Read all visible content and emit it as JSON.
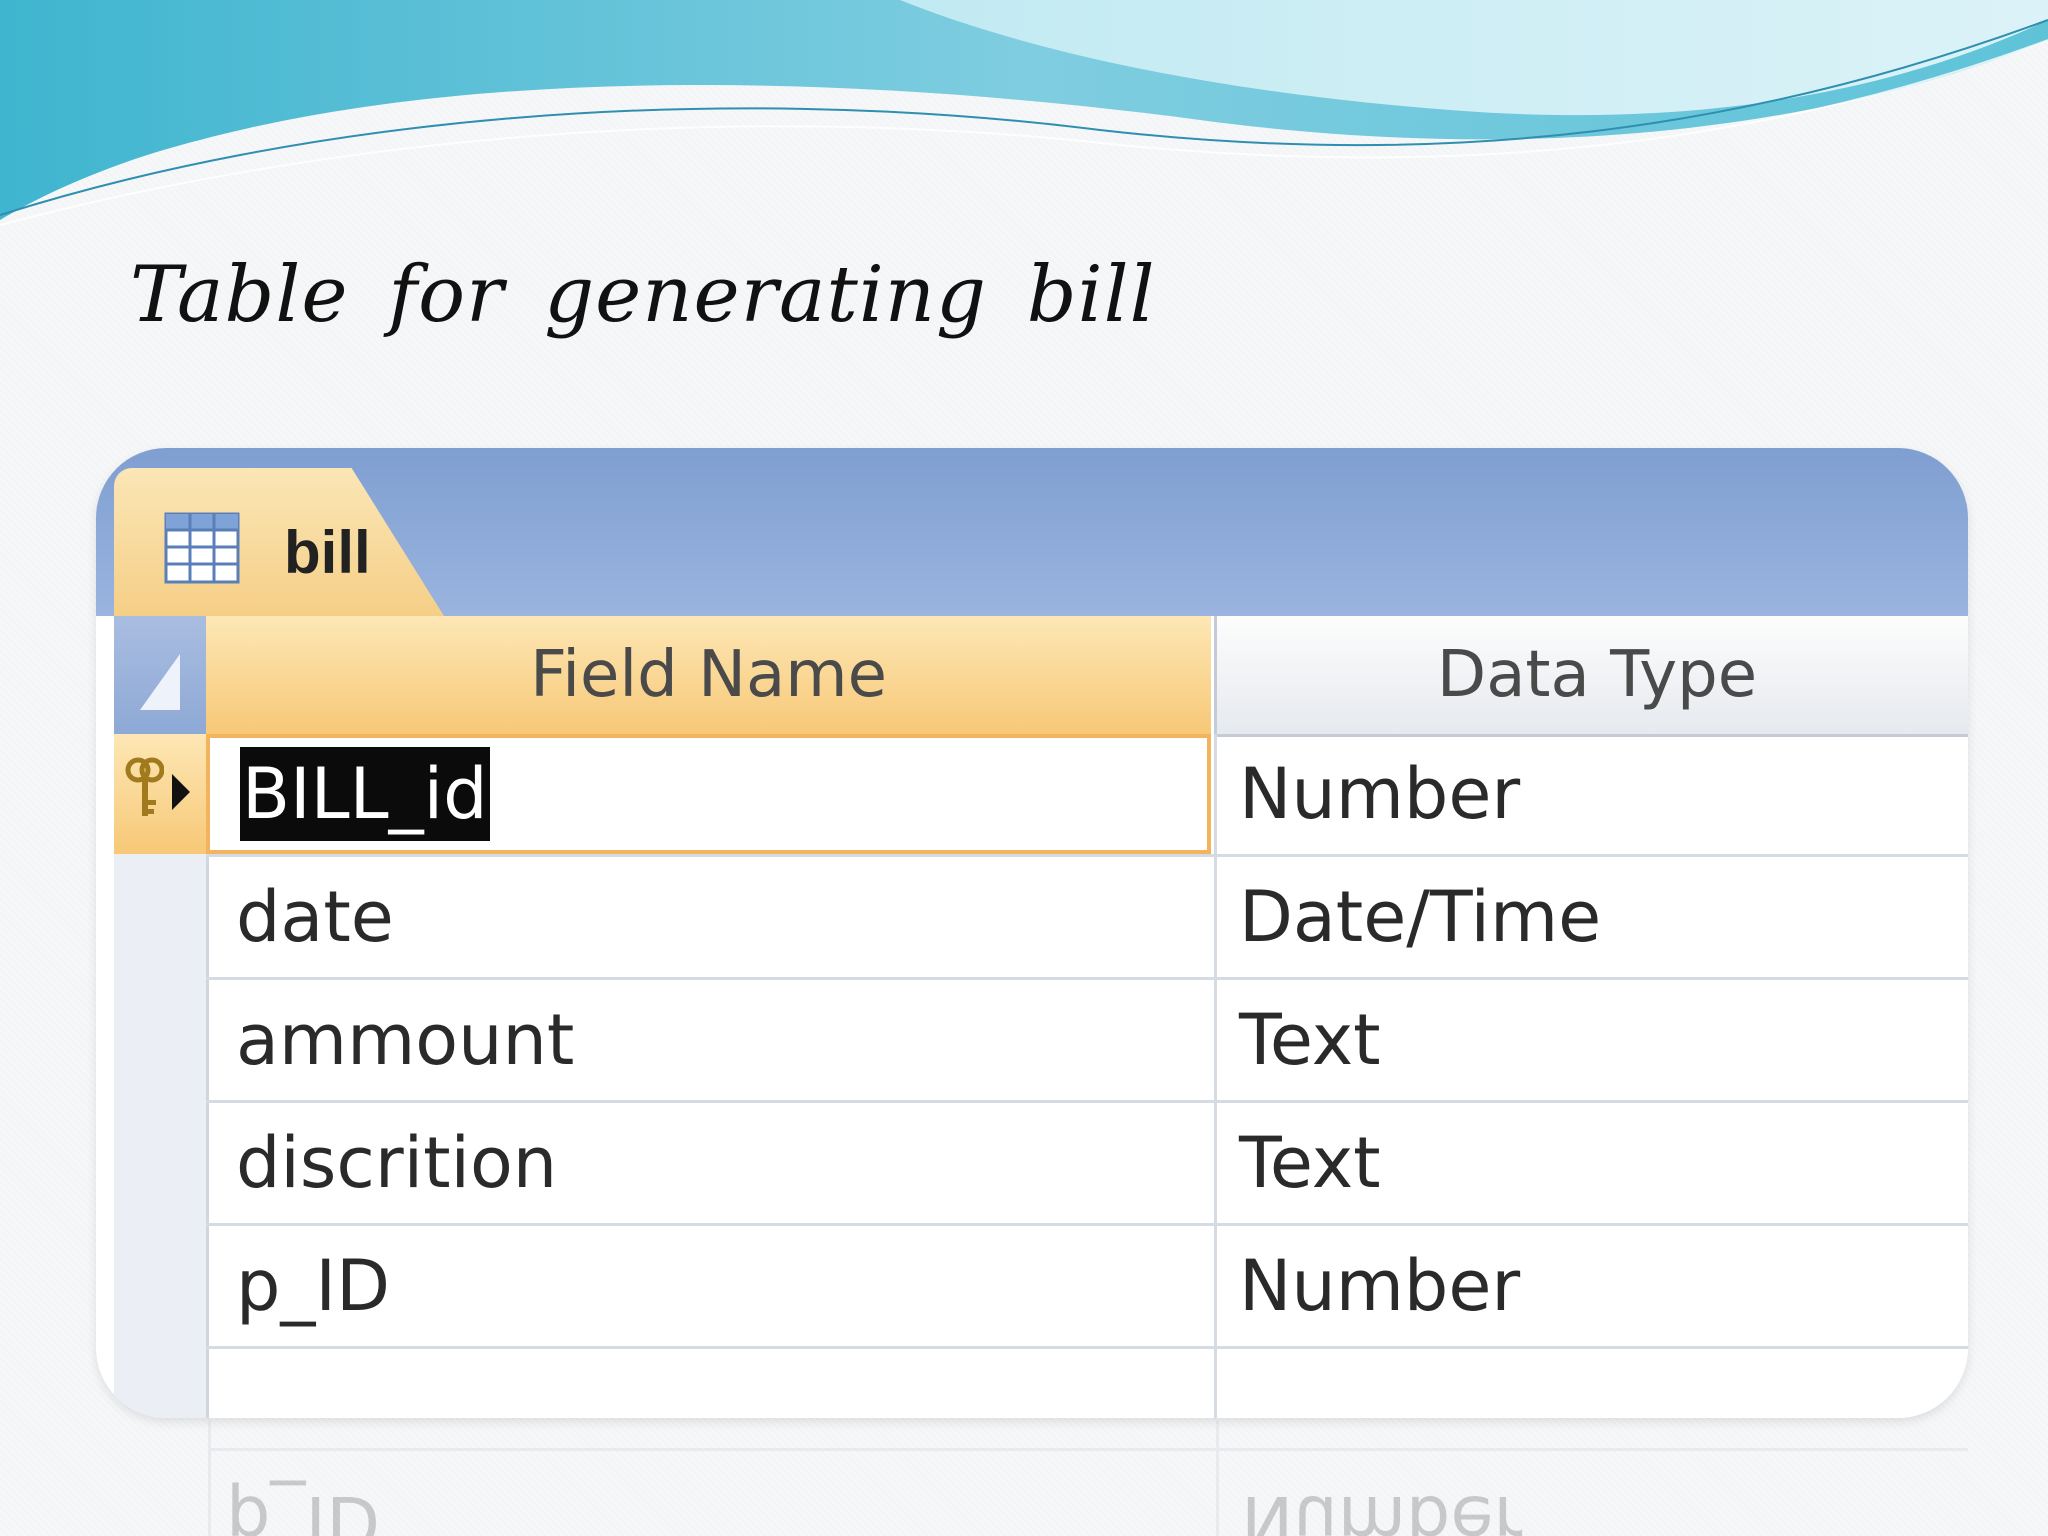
{
  "slide": {
    "title": "Table for generating bill"
  },
  "table_window": {
    "tab_label": "bill",
    "tab_icon": "table-grid-icon",
    "columns": {
      "field_name": "Field Name",
      "data_type": "Data Type"
    },
    "rows": [
      {
        "field": "BILL_id",
        "type": "Number"
      },
      {
        "field": "date",
        "type": "Date/Time"
      },
      {
        "field": "ammount",
        "type": "Text"
      },
      {
        "field": "discrition",
        "type": "Text"
      },
      {
        "field": "p_ID",
        "type": "Number"
      },
      {
        "field": "",
        "type": ""
      }
    ],
    "primary_key_icon": "key-icon",
    "current_row_icon": "current-row-arrow-icon"
  },
  "colors": {
    "tab_bg": "#8ea9d6",
    "active_header": "#f7c877",
    "selection_bg": "#0b0b0b",
    "wave_teal": "#5fc3d8"
  }
}
